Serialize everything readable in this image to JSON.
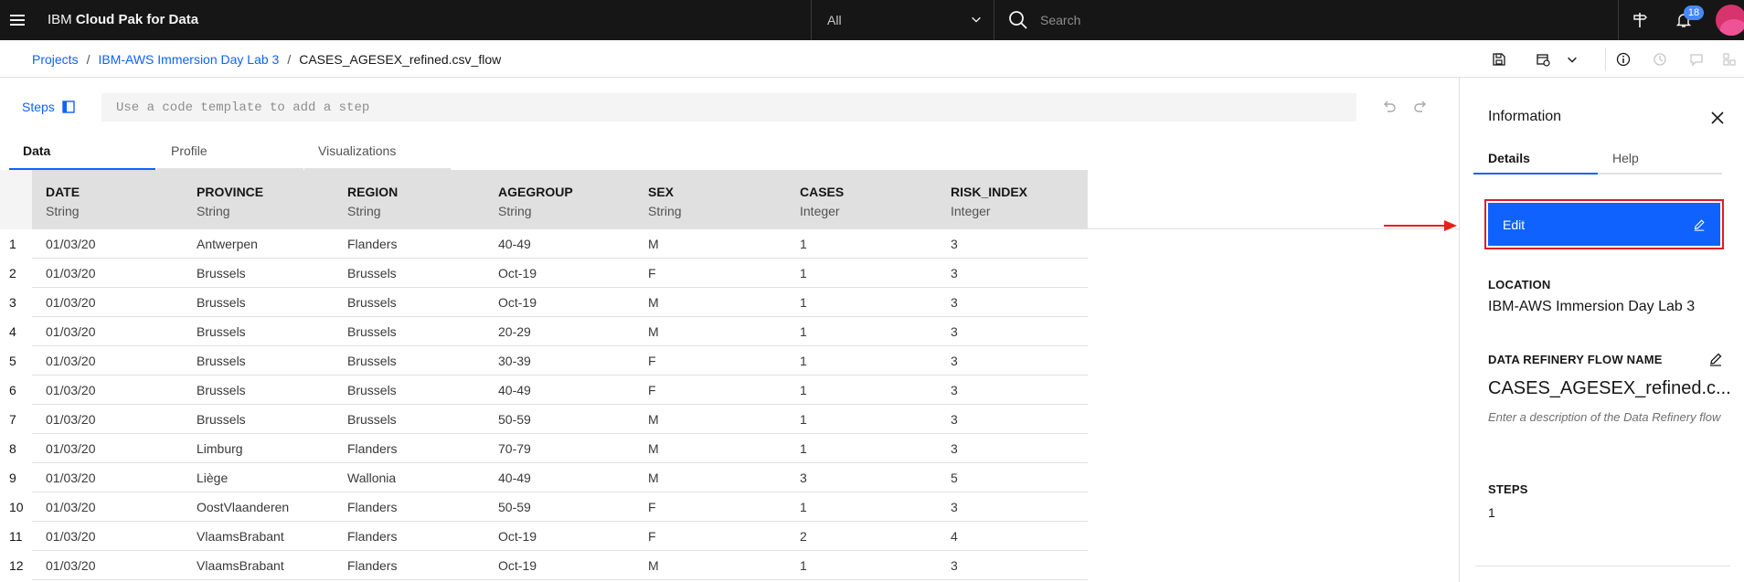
{
  "header": {
    "brand_prefix": "IBM",
    "brand_name": "Cloud Pak for Data",
    "scope_selected": "All",
    "search_placeholder": "Search",
    "notification_count": "18"
  },
  "breadcrumb": {
    "items": [
      "Projects",
      "IBM-AWS Immersion Day Lab 3"
    ],
    "current": "CASES_AGESEX_refined.csv_flow"
  },
  "steps": {
    "label": "Steps",
    "code_placeholder": "Use a code template to add a step"
  },
  "tabs": [
    "Data",
    "Profile",
    "Visualizations"
  ],
  "grid": {
    "columns": [
      {
        "name": "DATE",
        "type": "String"
      },
      {
        "name": "PROVINCE",
        "type": "String"
      },
      {
        "name": "REGION",
        "type": "String"
      },
      {
        "name": "AGEGROUP",
        "type": "String"
      },
      {
        "name": "SEX",
        "type": "String"
      },
      {
        "name": "CASES",
        "type": "Integer"
      },
      {
        "name": "RISK_INDEX",
        "type": "Integer"
      }
    ],
    "rows": [
      [
        "1",
        "01/03/20",
        "Antwerpen",
        "Flanders",
        "40-49",
        "M",
        "1",
        "3"
      ],
      [
        "2",
        "01/03/20",
        "Brussels",
        "Brussels",
        "Oct-19",
        "F",
        "1",
        "3"
      ],
      [
        "3",
        "01/03/20",
        "Brussels",
        "Brussels",
        "Oct-19",
        "M",
        "1",
        "3"
      ],
      [
        "4",
        "01/03/20",
        "Brussels",
        "Brussels",
        "20-29",
        "M",
        "1",
        "3"
      ],
      [
        "5",
        "01/03/20",
        "Brussels",
        "Brussels",
        "30-39",
        "F",
        "1",
        "3"
      ],
      [
        "6",
        "01/03/20",
        "Brussels",
        "Brussels",
        "40-49",
        "F",
        "1",
        "3"
      ],
      [
        "7",
        "01/03/20",
        "Brussels",
        "Brussels",
        "50-59",
        "M",
        "1",
        "3"
      ],
      [
        "8",
        "01/03/20",
        "Limburg",
        "Flanders",
        "70-79",
        "M",
        "1",
        "3"
      ],
      [
        "9",
        "01/03/20",
        "Liège",
        "Wallonia",
        "40-49",
        "M",
        "3",
        "5"
      ],
      [
        "10",
        "01/03/20",
        "OostVlaanderen",
        "Flanders",
        "50-59",
        "F",
        "1",
        "3"
      ],
      [
        "11",
        "01/03/20",
        "VlaamsBrabant",
        "Flanders",
        "Oct-19",
        "F",
        "2",
        "4"
      ],
      [
        "12",
        "01/03/20",
        "VlaamsBrabant",
        "Flanders",
        "Oct-19",
        "M",
        "1",
        "3"
      ]
    ]
  },
  "panel": {
    "title": "Information",
    "tabs": [
      "Details",
      "Help"
    ],
    "edit_label": "Edit",
    "location_label": "LOCATION",
    "location_value": "IBM-AWS Immersion Day Lab 3",
    "flow_name_label": "DATA REFINERY FLOW NAME",
    "flow_name_value": "CASES_AGESEX_refined.c...",
    "description_placeholder": "Enter a description of the Data Refinery flow",
    "steps_label": "STEPS",
    "steps_value": "1"
  },
  "colors": {
    "accent": "#0f62fe",
    "header_bg": "#161616",
    "highlight": "#da1e28"
  }
}
